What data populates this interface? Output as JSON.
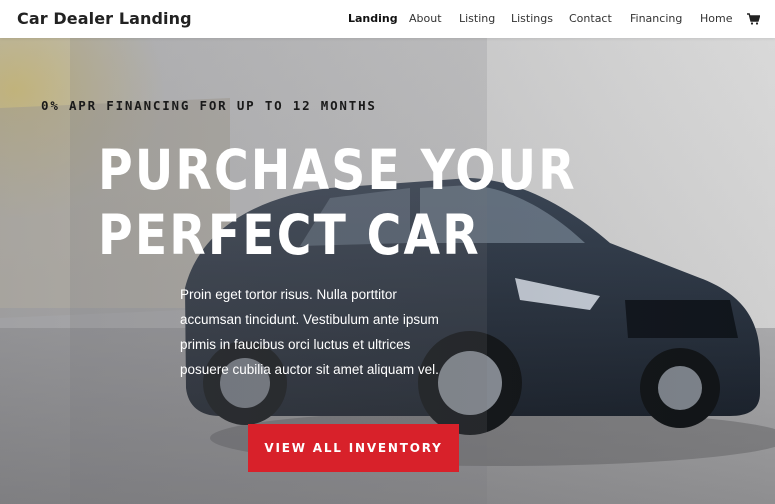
{
  "header": {
    "logo": "Car Dealer Landing",
    "nav": [
      {
        "label": "Landing",
        "active": true
      },
      {
        "label": "About"
      },
      {
        "label": "Listing"
      },
      {
        "label": "Listings"
      },
      {
        "label": "Contact"
      },
      {
        "label": "Financing"
      },
      {
        "label": "Home"
      }
    ],
    "cart_icon": "cart-icon"
  },
  "hero": {
    "promo": "0% APR FINANCING FOR UP TO 12 MONTHS",
    "headline_line1": "PURCHASE YOUR",
    "headline_line2": "PERFECT CAR",
    "body_lines": [
      "Proin eget tortor risus. Nulla porttitor",
      "accumsan tincidunt. Vestibulum ante ipsum",
      "primis in faucibus orci luctus et ultrices",
      "posuere cubilia auctor sit amet aliquam vel."
    ],
    "cta_label": "VIEW ALL INVENTORY"
  },
  "colors": {
    "accent": "#d8212a",
    "header_bg": "#ffffff",
    "text_dark": "#222222",
    "hero_text": "#ffffff"
  }
}
